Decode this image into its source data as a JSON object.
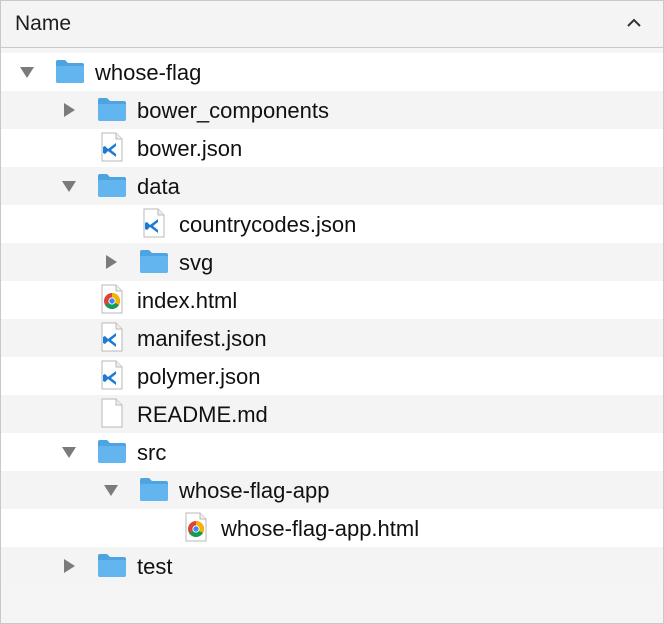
{
  "header": {
    "column_name": "Name",
    "sort_icon": "chevron-up-icon"
  },
  "colors": {
    "folder": "#62b5ee",
    "folder_tab": "#4ea4e0",
    "vscode": "#1c7bd4",
    "triangle": "#7b7b7b",
    "zebra": "#f4f4f4"
  },
  "tree": [
    {
      "label": "whose-flag",
      "type": "folder",
      "expanded": true
    },
    {
      "label": "bower_components",
      "type": "folder",
      "expanded": false
    },
    {
      "label": "bower.json",
      "type": "vscode-file"
    },
    {
      "label": "data",
      "type": "folder",
      "expanded": true
    },
    {
      "label": "countrycodes.json",
      "type": "vscode-file"
    },
    {
      "label": "svg",
      "type": "folder",
      "expanded": false
    },
    {
      "label": "index.html",
      "type": "chrome-file"
    },
    {
      "label": "manifest.json",
      "type": "vscode-file"
    },
    {
      "label": "polymer.json",
      "type": "vscode-file"
    },
    {
      "label": "README.md",
      "type": "blank-file"
    },
    {
      "label": "src",
      "type": "folder",
      "expanded": true
    },
    {
      "label": "whose-flag-app",
      "type": "folder",
      "expanded": true
    },
    {
      "label": "whose-flag-app.html",
      "type": "chrome-file"
    },
    {
      "label": "test",
      "type": "folder",
      "expanded": false
    }
  ]
}
